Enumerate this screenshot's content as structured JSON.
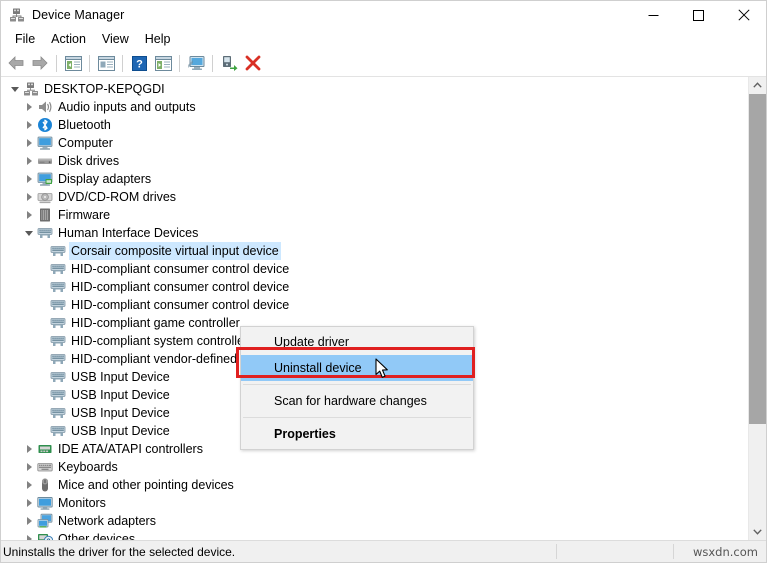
{
  "window": {
    "title": "Device Manager",
    "icon": "device-manager-icon",
    "controls": {
      "minimize": "minimize-icon",
      "maximize": "maximize-icon",
      "close": "close-icon"
    }
  },
  "menubar": {
    "items": [
      {
        "label": "File"
      },
      {
        "label": "Action"
      },
      {
        "label": "View"
      },
      {
        "label": "Help"
      }
    ]
  },
  "toolbar": {
    "buttons": [
      {
        "name": "back-icon"
      },
      {
        "name": "forward-icon"
      },
      {
        "name": "separator"
      },
      {
        "name": "show-hide-console-tree-icon"
      },
      {
        "name": "separator"
      },
      {
        "name": "properties-icon"
      },
      {
        "name": "separator"
      },
      {
        "name": "help-icon"
      },
      {
        "name": "update-driver-icon"
      },
      {
        "name": "separator"
      },
      {
        "name": "scan-for-hardware-changes-icon"
      },
      {
        "name": "separator"
      },
      {
        "name": "enable-device-icon"
      },
      {
        "name": "uninstall-device-icon"
      }
    ]
  },
  "tree": {
    "nodes": [
      {
        "label": "DESKTOP-KEPQGDI",
        "level": 0,
        "expanded": true,
        "icon": "computer-root-icon",
        "selected": false
      },
      {
        "label": "Audio inputs and outputs",
        "level": 1,
        "expanded": false,
        "icon": "speaker-icon",
        "selected": false
      },
      {
        "label": "Bluetooth",
        "level": 1,
        "expanded": false,
        "icon": "bluetooth-icon",
        "selected": false
      },
      {
        "label": "Computer",
        "level": 1,
        "expanded": false,
        "icon": "computer-icon",
        "selected": false
      },
      {
        "label": "Disk drives",
        "level": 1,
        "expanded": false,
        "icon": "disk-drive-icon",
        "selected": false
      },
      {
        "label": "Display adapters",
        "level": 1,
        "expanded": false,
        "icon": "display-adapter-icon",
        "selected": false
      },
      {
        "label": "DVD/CD-ROM drives",
        "level": 1,
        "expanded": false,
        "icon": "dvd-drive-icon",
        "selected": false
      },
      {
        "label": "Firmware",
        "level": 1,
        "expanded": false,
        "icon": "firmware-icon",
        "selected": false
      },
      {
        "label": "Human Interface Devices",
        "level": 1,
        "expanded": true,
        "icon": "hid-icon",
        "selected": false
      },
      {
        "label": "Corsair composite virtual input device",
        "level": 2,
        "expanded": null,
        "icon": "hid-device-icon",
        "selected": true
      },
      {
        "label": "HID-compliant consumer control device",
        "level": 2,
        "expanded": null,
        "icon": "hid-device-icon",
        "selected": false
      },
      {
        "label": "HID-compliant consumer control device",
        "level": 2,
        "expanded": null,
        "icon": "hid-device-icon",
        "selected": false
      },
      {
        "label": "HID-compliant consumer control device",
        "level": 2,
        "expanded": null,
        "icon": "hid-device-icon",
        "selected": false
      },
      {
        "label": "HID-compliant game controller",
        "level": 2,
        "expanded": null,
        "icon": "hid-device-icon",
        "selected": false
      },
      {
        "label": "HID-compliant system controller",
        "level": 2,
        "expanded": null,
        "icon": "hid-device-icon",
        "selected": false
      },
      {
        "label": "HID-compliant vendor-defined device",
        "level": 2,
        "expanded": null,
        "icon": "hid-device-icon",
        "selected": false
      },
      {
        "label": "USB Input Device",
        "level": 2,
        "expanded": null,
        "icon": "hid-device-icon",
        "selected": false
      },
      {
        "label": "USB Input Device",
        "level": 2,
        "expanded": null,
        "icon": "hid-device-icon",
        "selected": false
      },
      {
        "label": "USB Input Device",
        "level": 2,
        "expanded": null,
        "icon": "hid-device-icon",
        "selected": false
      },
      {
        "label": "USB Input Device",
        "level": 2,
        "expanded": null,
        "icon": "hid-device-icon",
        "selected": false
      },
      {
        "label": "IDE ATA/ATAPI controllers",
        "level": 1,
        "expanded": false,
        "icon": "ide-controller-icon",
        "selected": false
      },
      {
        "label": "Keyboards",
        "level": 1,
        "expanded": false,
        "icon": "keyboard-icon",
        "selected": false
      },
      {
        "label": "Mice and other pointing devices",
        "level": 1,
        "expanded": false,
        "icon": "mouse-icon",
        "selected": false
      },
      {
        "label": "Monitors",
        "level": 1,
        "expanded": false,
        "icon": "monitor-icon",
        "selected": false
      },
      {
        "label": "Network adapters",
        "level": 1,
        "expanded": false,
        "icon": "network-adapter-icon",
        "selected": false
      },
      {
        "label": "Other devices",
        "level": 1,
        "expanded": false,
        "icon": "other-devices-icon",
        "selected": false
      }
    ]
  },
  "context_menu": {
    "items": [
      {
        "label": "Update driver",
        "highlighted": false,
        "bold": false
      },
      {
        "label": "Uninstall device",
        "highlighted": true,
        "bold": false
      },
      {
        "label": "Scan for hardware changes",
        "highlighted": false,
        "bold": false
      },
      {
        "label": "Properties",
        "highlighted": false,
        "bold": true
      }
    ]
  },
  "statusbar": {
    "text": "Uninstalls the driver for the selected device.",
    "watermark": "wsxdn.com"
  },
  "colors": {
    "selection_blue": "#cde8ff",
    "menu_highlight": "#91c9f7",
    "annotation_red": "#e02020",
    "scrollbar_thumb": "#a6a6a6"
  }
}
